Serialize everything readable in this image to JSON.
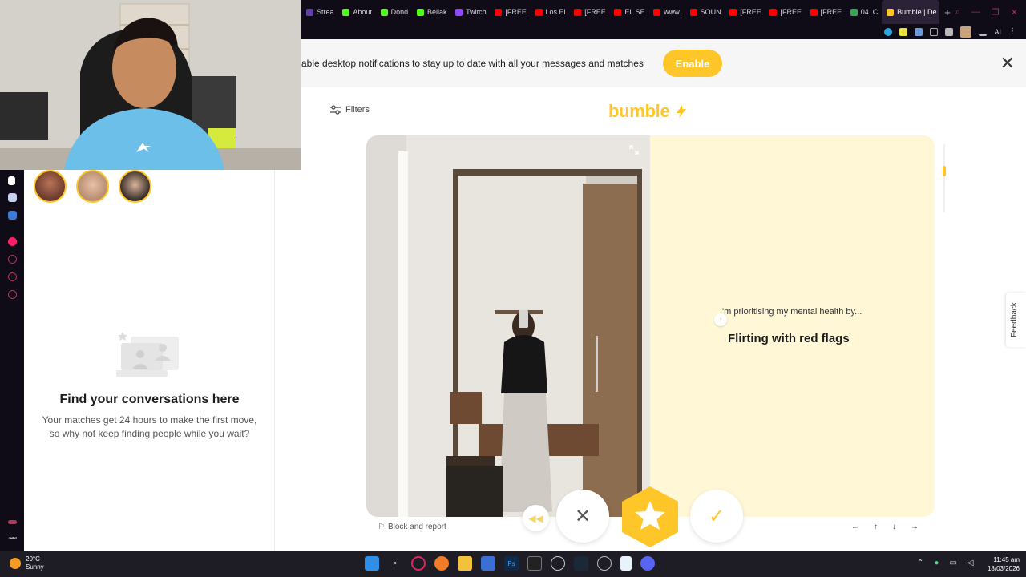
{
  "browser": {
    "tabs": [
      {
        "label": "Strea",
        "color": "#6441a5"
      },
      {
        "label": "About",
        "color": "#53fc18"
      },
      {
        "label": "Dond",
        "color": "#53fc18"
      },
      {
        "label": "Bellak",
        "color": "#53fc18"
      },
      {
        "label": "Twitch",
        "color": "#9146ff"
      },
      {
        "label": "[FREE",
        "color": "#ff0000"
      },
      {
        "label": "Los El",
        "color": "#ff0000"
      },
      {
        "label": "[FREE",
        "color": "#ff0000"
      },
      {
        "label": "EL SE",
        "color": "#ff0000"
      },
      {
        "label": "www.",
        "color": "#ff0000"
      },
      {
        "label": "SOUN",
        "color": "#ff0000"
      },
      {
        "label": "[FREE",
        "color": "#ff0000"
      },
      {
        "label": "[FREE",
        "color": "#ff0000"
      },
      {
        "label": "[FREE",
        "color": "#ff0000"
      },
      {
        "label": "04. C",
        "color": "#34a853"
      }
    ],
    "active_tab": {
      "label": "Bumble | De",
      "color": "#ffc629"
    },
    "new_tab": "+",
    "toolbar_ai": "AI"
  },
  "notification": {
    "text": "able desktop notifications to stay up to date with all your messages and matches",
    "button": "Enable",
    "close": "✕"
  },
  "sidebar": {
    "empty_title": "Find your conversations here",
    "empty_subtitle": "Your matches get 24 hours to make the first move, so why not keep finding people while you wait?"
  },
  "main": {
    "filters_label": "Filters",
    "logo": "bumble",
    "prompt_question": "I'm prioritising my mental health by...",
    "prompt_answer": "Flirting with red flags",
    "block_report": "Block and report",
    "nav_keys": [
      "←",
      "↑",
      "↓",
      "→"
    ],
    "feedback": "Feedback"
  },
  "taskbar": {
    "temperature": "20°C",
    "weather": "Sunny",
    "time": "11:45 am",
    "date": "18/03/2026"
  },
  "colors": {
    "brand": "#ffc629",
    "card_bg": "#fff7d6",
    "browser_dark": "#0f0b17"
  }
}
